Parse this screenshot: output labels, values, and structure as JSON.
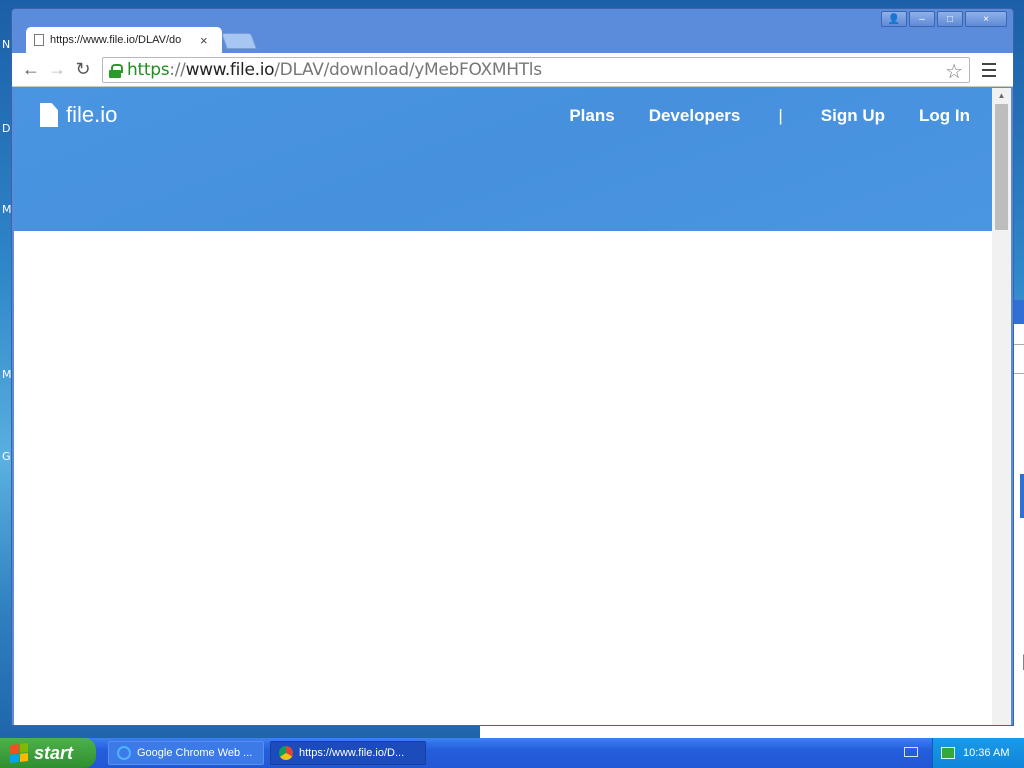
{
  "desktop": {
    "letters": [
      "N",
      "D",
      "M",
      "M",
      "G"
    ],
    "background_text": "n"
  },
  "browser": {
    "tab": {
      "title": "https://www.file.io/DLAV/do",
      "close": "×"
    },
    "window_buttons": {
      "user": "👤",
      "minimize": "–",
      "maximize": "□",
      "close": "×"
    },
    "nav": {
      "back": "←",
      "forward": "→",
      "reload": "↻"
    },
    "url": {
      "scheme": "https",
      "sep": "://",
      "host": "www.file.io",
      "path": "/DLAV/download/yMebFOXMHTls"
    },
    "star": "☆"
  },
  "page": {
    "brand": "file.io",
    "nav": [
      "Plans",
      "Developers",
      "|",
      "Sign Up",
      "Log In"
    ],
    "scroll_up": "▲"
  },
  "taskbar": {
    "start_label": "start",
    "tasks": [
      "Google Chrome Web ...",
      "https://www.file.io/D..."
    ],
    "clock": "10:36 AM"
  },
  "colors": {
    "hero": "#4a95e2",
    "url_scheme": "#1f8f1f",
    "taskbar": "#245edc",
    "start": "#3a9a3a"
  }
}
